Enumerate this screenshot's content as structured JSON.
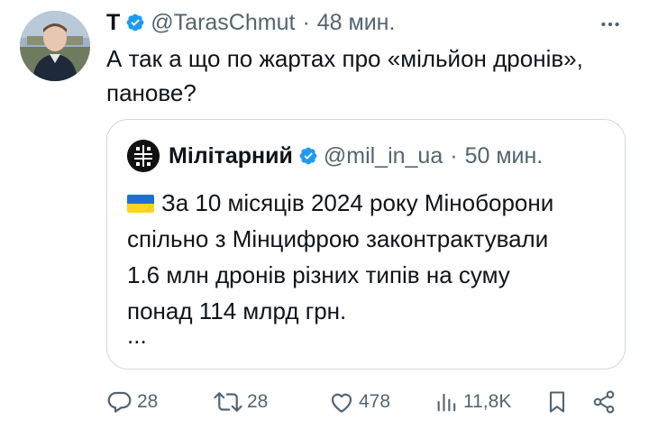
{
  "author": {
    "display_name": "T",
    "handle": "@TarasChmut",
    "time": "48 мин.",
    "separator": "·"
  },
  "tweet": {
    "text_line1": "А так а що по жартах про «мільйон дронів»,",
    "text_line2": "панове?"
  },
  "quote": {
    "display_name": "Мілітарний",
    "handle": "@mil_in_ua",
    "separator": "·",
    "time": "50 мин.",
    "line1": "За 10 місяців 2024 року Міноборони",
    "line2": "спільно з Мінцифрою законтрактували",
    "line3": "1.6 млн дронів різних типів на суму",
    "line4": "понад 114 млрд грн.",
    "truncation": "..."
  },
  "actions": {
    "replies": "28",
    "retweets": "28",
    "likes": "478",
    "views": "11,8K"
  },
  "colors": {
    "verified": "#1d9bf0",
    "muted": "#536471",
    "border": "#cfd9de",
    "text": "#0f1419",
    "flag_blue": "#1f6fd1",
    "flag_yellow": "#ffd21f"
  },
  "icons": [
    "verified-badge-icon",
    "more-options-icon",
    "reply-icon",
    "retweet-icon",
    "like-icon",
    "views-icon",
    "bookmark-icon",
    "share-icon",
    "ukraine-flag-icon"
  ]
}
